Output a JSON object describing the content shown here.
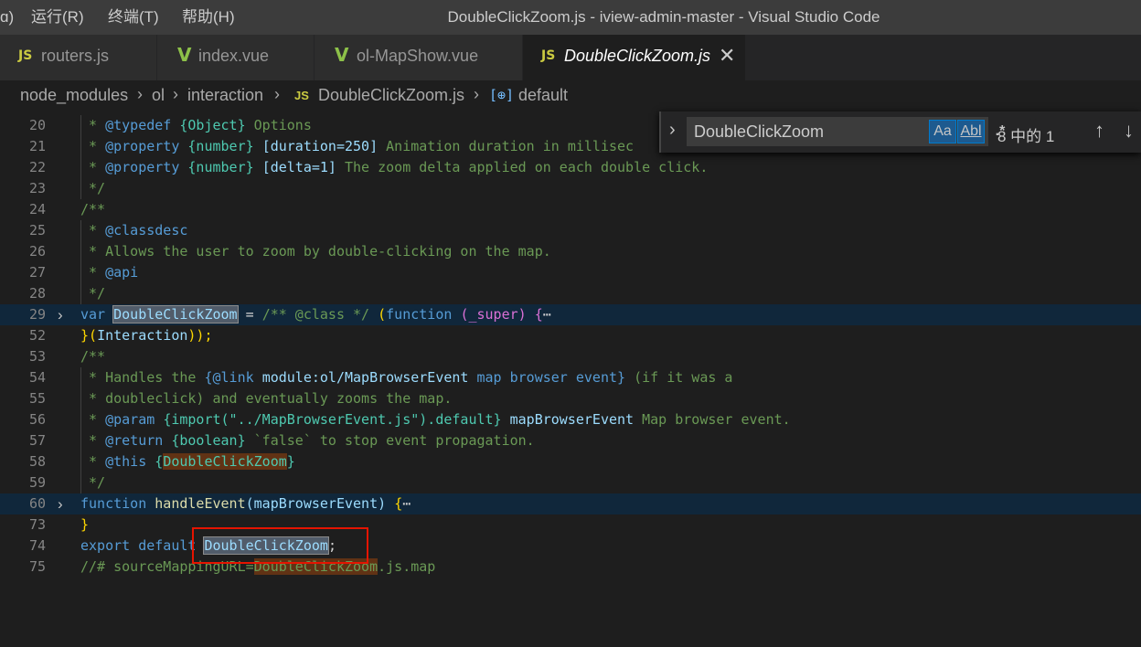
{
  "titlebar": {
    "menus": [
      "ɑ)",
      "运行(R)",
      "终端(T)",
      "帮助(H)"
    ],
    "window_title": "DoubleClickZoom.js - iview-admin-master - Visual Studio Code"
  },
  "tabs": [
    {
      "icon": "JS",
      "label": "routers.js"
    },
    {
      "icon": "V",
      "label": "index.vue"
    },
    {
      "icon": "V",
      "label": "ol-MapShow.vue"
    },
    {
      "icon": "JS",
      "label": "DoubleClickZoom.js",
      "close": "✕"
    }
  ],
  "breadcrumb": {
    "items": [
      "node_modules",
      "ol",
      "interaction",
      "DoubleClickZoom.js",
      "default"
    ],
    "file_icon": "JS",
    "symbol_icon": "[⊕]",
    "separator": "›"
  },
  "find": {
    "expand": "›",
    "query": "DoubleClickZoom",
    "opt_case": "Aa",
    "opt_word": "Abl",
    "opt_regex": ".*",
    "count": "8 中的 1",
    "prev": "↑",
    "next": "↓"
  },
  "code": {
    "line_numbers": [
      "20",
      "21",
      "22",
      "23",
      "24",
      "25",
      "26",
      "27",
      "28",
      "29",
      "52",
      "53",
      "54",
      "55",
      "56",
      "57",
      "58",
      "59",
      "60",
      "73",
      "74",
      "75"
    ],
    "fold_chevron": "›",
    "ellipsis": "⋯",
    "l20": [
      "@typedef",
      "{Object}",
      "Options"
    ],
    "l21": [
      "@property",
      "{number}",
      "[duration=250]",
      "Animation duration in millisec"
    ],
    "l22": [
      "@property",
      "{number}",
      "[delta=1]",
      "The zoom delta applied on each double click."
    ],
    "l23": "*/",
    "l24": "/**",
    "l25": "@classdesc",
    "l26": "Allows the user to zoom by double-clicking on the map.",
    "l27": "@api",
    "l28": "*/",
    "l29": [
      "var",
      "DoubleClickZoom",
      "=",
      "/** @class */",
      "(",
      "function",
      "(_super)",
      "{"
    ],
    "l52": [
      "}(",
      "Interaction",
      "));"
    ],
    "l53": "/**",
    "l54": [
      "Handles the",
      "{@link",
      "module:ol/MapBrowserEvent",
      "map browser event}",
      "(if it was a"
    ],
    "l55": "doubleclick) and eventually zooms the map.",
    "l56": [
      "@param",
      "{import(\"../MapBrowserEvent.js\").default}",
      "mapBrowserEvent",
      "Map browser event."
    ],
    "l57": [
      "@return",
      "{boolean}",
      "`false` to stop event propagation."
    ],
    "l58": [
      "@this",
      "{",
      "DoubleClickZoom",
      "}"
    ],
    "l59": "*/",
    "l60": [
      "function",
      "handleEvent",
      "(mapBrowserEvent)",
      "{"
    ],
    "l73": "}",
    "l74": [
      "export",
      "default",
      "DoubleClickZoom",
      ";"
    ],
    "l75": [
      "//# sourceMappingURL=",
      "DoubleClickZoom",
      ".js.map"
    ]
  }
}
